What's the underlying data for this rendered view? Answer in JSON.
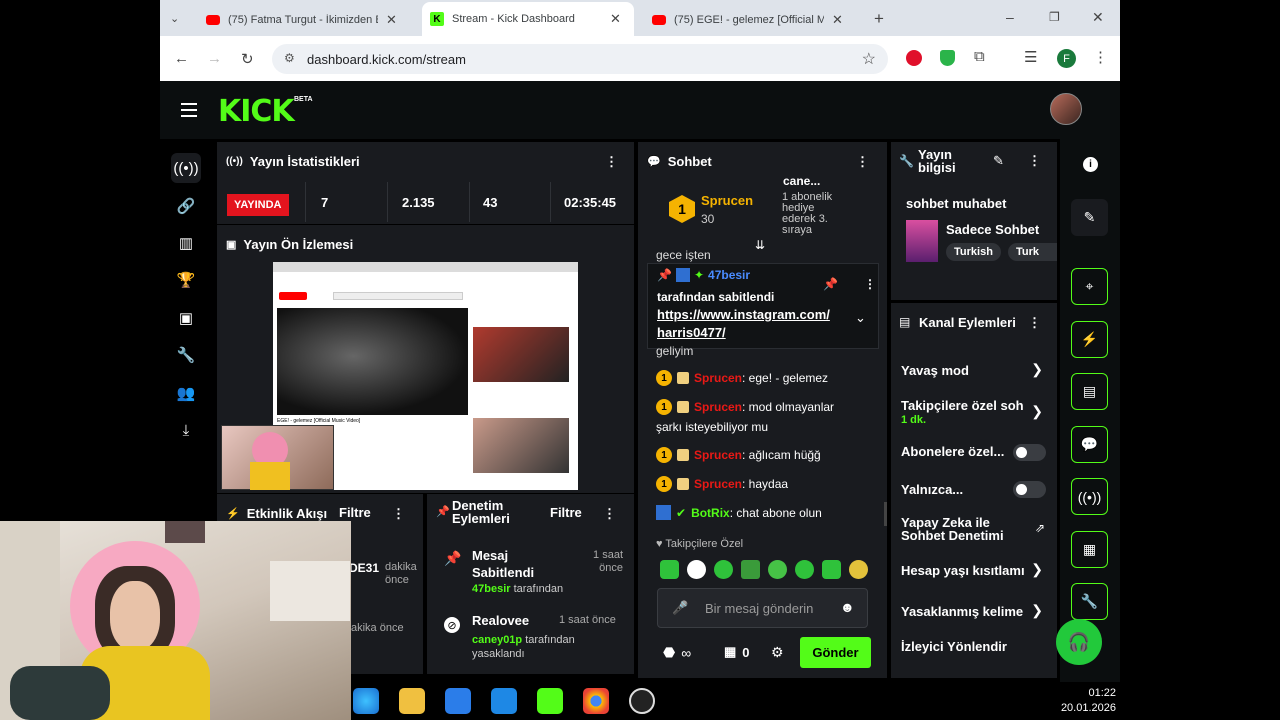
{
  "browser": {
    "tabs": [
      {
        "title": "(75) Fatma Turgut - İkimizden B"
      },
      {
        "title": "Stream - Kick Dashboard"
      },
      {
        "title": "(75) EGE! - gelemez [Official Mu"
      }
    ],
    "url": "dashboard.kick.com/stream",
    "profile_letter": "F"
  },
  "app": {
    "logo": "KICK",
    "beta": "BETA"
  },
  "stats": {
    "title": "Yayın İstatistikleri",
    "live_label": "YAYINDA",
    "viewers": "7",
    "followers": "2.135",
    "subs": "43",
    "uptime": "02:35:45"
  },
  "preview": {
    "title": "Yayın Ön İzlemesi",
    "video_caption": "EGE! - gelemez [Official Music Video]"
  },
  "activity": {
    "title": "Etkinlik Akışı",
    "filter": "Filtre",
    "row1_name": "DE31",
    "row1_time": "dakika önce",
    "row2_time": "akika önce"
  },
  "moderation": {
    "title": "Denetim Eylemleri",
    "filter": "Filtre",
    "items": [
      {
        "action": "Mesaj Sabitlendi",
        "time": "1 saat önce",
        "user": "47besir",
        "suffix": "tarafından"
      },
      {
        "action": "Realovee",
        "time": "1 saat önce",
        "user": "caney01p",
        "suffix": "tarafından yasaklandı"
      }
    ]
  },
  "chat": {
    "title": "Sohbet",
    "top_gifter": "Sprucen",
    "top_gifter_count": "30",
    "gift_user": "cane...",
    "gift_text": "1 abonelik hediye ederek 3. sıraya",
    "cut_text": "gece işten",
    "pinned_user": "47besir",
    "pinned_by": "tarafından sabitlendi",
    "pinned_link": "https://www.instagram.com/ harris0477/",
    "cut_text2": "geliyim",
    "messages": [
      {
        "user": "Sprucen",
        "text": ": ege! - gelemez"
      },
      {
        "user": "Sprucen",
        "text": ": mod olmayanlar"
      },
      {
        "user": "",
        "text": "şarkı isteyebiliyor mu"
      },
      {
        "user": "Sprucen",
        "text": ": ağlıcam hüğğ"
      },
      {
        "user": "Sprucen",
        "text": ": haydaa"
      },
      {
        "user": "BotRix",
        "text": ": chat abone olun"
      }
    ],
    "followers_only": "Takipçilere Özel",
    "input_placeholder": "Bir mesaj gönderin",
    "send": "Gönder",
    "count_a": "∞",
    "count_b": "0"
  },
  "info": {
    "title": "Yayın bilgisi",
    "stream_title": "sohbet muhabet",
    "category": "Sadece Sohbet",
    "tag1": "Turkish",
    "tag2": "Turk"
  },
  "channel": {
    "title": "Kanal Eylemleri",
    "slow_mode": "Yavaş mod",
    "followers_mode": "Takipçilere özel soh",
    "followers_mode_sub": "1 dk.",
    "subs_mode": "Abonelere özel...",
    "only_mode": "Yalnızca...",
    "ai_mod": "Yapay Zeka ile Sohbet Denetimi",
    "age": "Hesap yaşı kısıtlamı",
    "banned_words": "Yasaklanmış kelime",
    "redirect": "İzleyici Yönlendir"
  },
  "taskbar": {
    "time": "01:22",
    "date": "20.01.2026"
  },
  "colors": {
    "accent": "#53fc18",
    "live": "#e3141e",
    "panel": "#191b1f",
    "username_red": "#e91916"
  }
}
